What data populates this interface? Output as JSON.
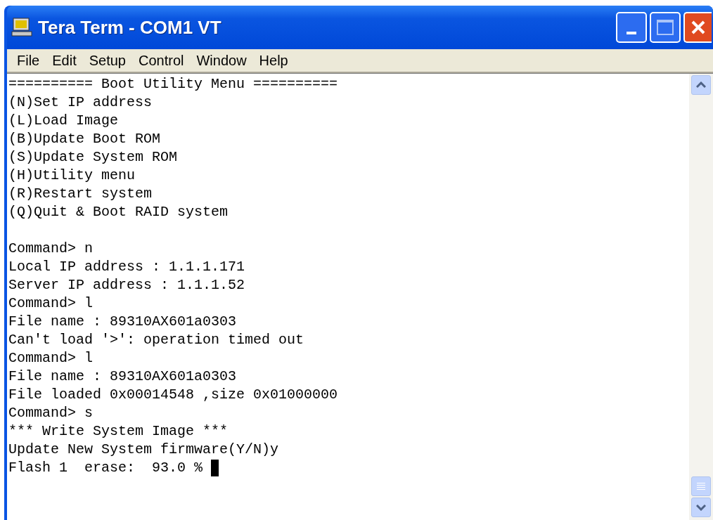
{
  "window": {
    "title": "Tera Term - COM1 VT"
  },
  "menu": [
    "File",
    "Edit",
    "Setup",
    "Control",
    "Window",
    "Help"
  ],
  "terminal": {
    "sections": [
      [
        "========== Boot Utility Menu ==========",
        "(N)Set IP address",
        "(L)Load Image",
        "(B)Update Boot ROM",
        "(S)Update System ROM",
        "(H)Utility menu",
        "(R)Restart system",
        "(Q)Quit & Boot RAID system"
      ],
      [
        "Command> n",
        "Local IP address : 1.1.1.171",
        "Server IP address : 1.1.1.52",
        "Command> l",
        "File name : 89310AX601a0303",
        "Can't load '>': operation timed out",
        "Command> l",
        "File name : 89310AX601a0303",
        "File loaded 0x00014548 ,size 0x01000000",
        "Command> s",
        "*** Write System Image ***",
        "Update New System firmware(Y/N)y",
        "Flash 1  erase:  93.0 %"
      ]
    ],
    "cursor": true
  }
}
